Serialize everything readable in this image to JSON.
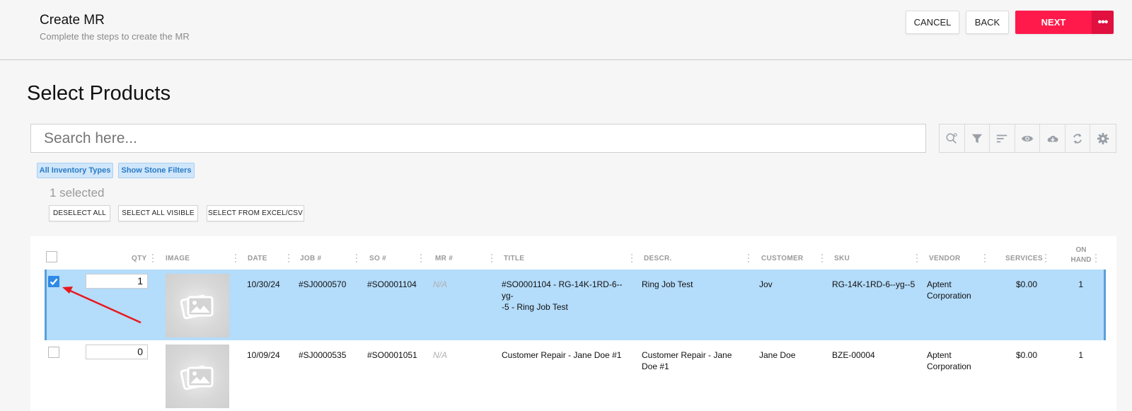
{
  "header": {
    "title": "Create MR",
    "subtitle": "Complete the steps to create the MR",
    "cancel_label": "CANCEL",
    "back_label": "BACK",
    "next_label": "NEXT",
    "more_label": "•••"
  },
  "page_title": "Select Products",
  "search": {
    "placeholder": "Search here..."
  },
  "toolbar": {
    "icons": [
      "search-advanced-icon",
      "filter-icon",
      "sort-icon",
      "eye-icon",
      "cloud-download-icon",
      "refresh-icon",
      "gear-icon"
    ]
  },
  "chips": {
    "inventory_types": "All Inventory Types",
    "stone_filters": "Show Stone Filters"
  },
  "selection": {
    "count_text": "1 selected",
    "deselect_all": "DESELECT ALL",
    "select_all_visible": "SELECT ALL VISIBLE",
    "select_from_excel": "SELECT FROM EXCEL/CSV"
  },
  "table": {
    "columns": {
      "qty": "QTY",
      "image": "IMAGE",
      "date": "DATE",
      "job": "JOB #",
      "so": "SO #",
      "mr": "MR #",
      "title": "TITLE",
      "descr": "DESCR.",
      "customer": "CUSTOMER",
      "sku": "SKU",
      "vendor": "VENDOR",
      "services": "SERVICES",
      "on_hand_1": "ON",
      "on_hand_2": "HAND"
    },
    "rows": [
      {
        "selected": true,
        "qty": "1",
        "date": "10/30/24",
        "job": "#SJ0000570",
        "so": "#SO0001104",
        "mr": "N/A",
        "title_1": "#SO0001104 - RG-14K-1RD-6--yg-",
        "title_2": "-5 - Ring Job Test",
        "descr_1": "Ring Job Test",
        "descr_2": "",
        "customer": "Jov",
        "sku": "RG-14K-1RD-6--yg--5",
        "vendor_1": "Aptent",
        "vendor_2": "Corporation",
        "services": "$0.00",
        "on_hand": "1"
      },
      {
        "selected": false,
        "qty": "0",
        "date": "10/09/24",
        "job": "#SJ0000535",
        "so": "#SO0001051",
        "mr": "N/A",
        "title_1": "Customer Repair - Jane Doe #1",
        "title_2": "",
        "descr_1": "Customer Repair - Jane",
        "descr_2": "Doe #1",
        "customer": "Jane Doe",
        "sku": "BZE-00004",
        "vendor_1": "Aptent",
        "vendor_2": "Corporation",
        "services": "$0.00",
        "on_hand": "1"
      }
    ]
  },
  "colors": {
    "accent_next": "#ff1a4b",
    "chip_bg": "#cfe6fb",
    "selected_row_bg": "#b4dcfb",
    "annotation_arrow": "#e8191f"
  }
}
